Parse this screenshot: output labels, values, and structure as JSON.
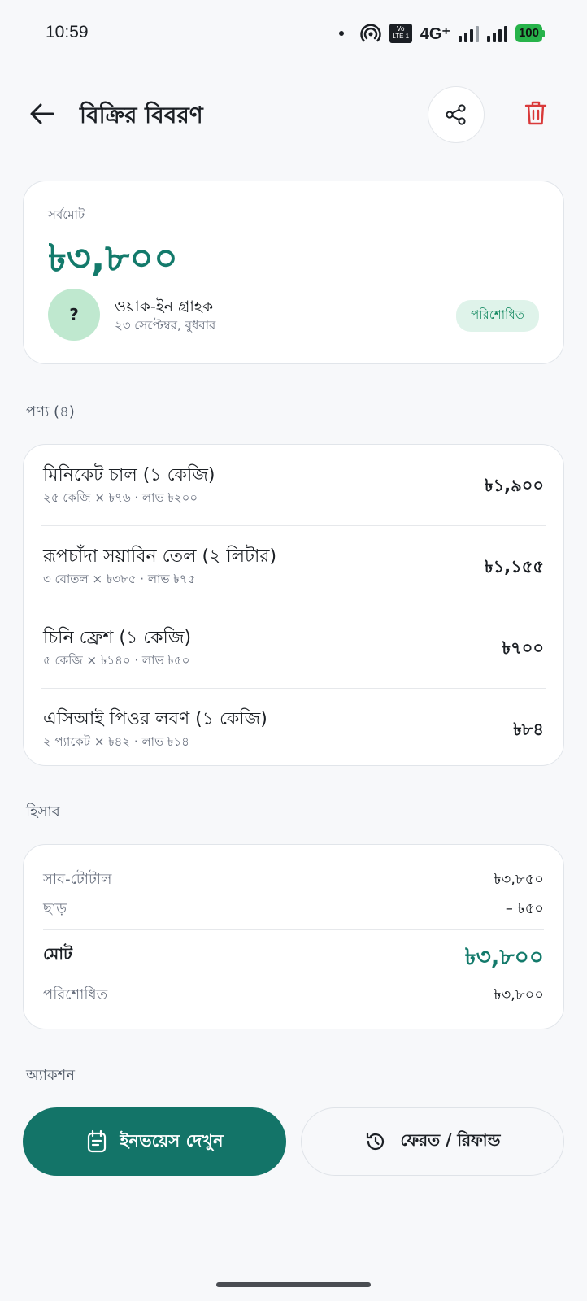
{
  "status_bar": {
    "time": "10:59",
    "network": "4G⁺",
    "volte": "Vo LTE 1",
    "battery": "100"
  },
  "header": {
    "title": "বিক্রির বিবরণ"
  },
  "summary": {
    "total_label": "সর্বমোট",
    "total_amount": "৳৩,৮০০",
    "avatar_text": "?",
    "customer_name": "ওয়াক-ইন গ্রাহক",
    "date": "২৩ সেপ্টেম্বর, বুধবার",
    "status": "পরিশোধিত"
  },
  "products_section": {
    "label": "পণ্য (৪)",
    "items": [
      {
        "name": "মিনিকেট চাল (১ কেজি)",
        "meta": "২৫ কেজি × ৳৭৬ · লাভ ৳২০০",
        "price": "৳১,৯০০"
      },
      {
        "name": "রূপচাঁদা সয়াবিন তেল (২ লিটার)",
        "meta": "৩ বোতল × ৳৩৮৫ · লাভ ৳৭৫",
        "price": "৳১,১৫৫"
      },
      {
        "name": "চিনি ফ্রেশ (১ কেজি)",
        "meta": "৫ কেজি × ৳১৪০ · লাভ ৳৫০",
        "price": "৳৭০০"
      },
      {
        "name": "এসিআই পিওর লবণ (১ কেজি)",
        "meta": "২ প্যাকেট × ৳৪২ · লাভ ৳১৪",
        "price": "৳৮৪"
      }
    ]
  },
  "accounts": {
    "label": "হিসাব",
    "subtotal_label": "সাব-টোটাল",
    "subtotal_value": "৳৩,৮৫০",
    "discount_label": "ছাড়",
    "discount_value": "– ৳৫০",
    "total_label": "মোট",
    "total_value": "৳৩,৮০০",
    "paid_label": "পরিশোধিত",
    "paid_value": "৳৩,৮০০"
  },
  "actions": {
    "label": "অ্যাকশন",
    "invoice_label": "ইনভয়েস দেখুন",
    "refund_label": "ফেরত / রিফান্ড"
  },
  "colors": {
    "accent": "#137a6b",
    "danger": "#d93a3a",
    "badge_bg": "#dff3ea",
    "avatar_bg": "#bfe8cf"
  },
  "icons": {
    "back": "arrow-left-icon",
    "share": "share-icon",
    "delete": "trash-icon",
    "invoice": "invoice-icon",
    "refund": "history-icon"
  }
}
